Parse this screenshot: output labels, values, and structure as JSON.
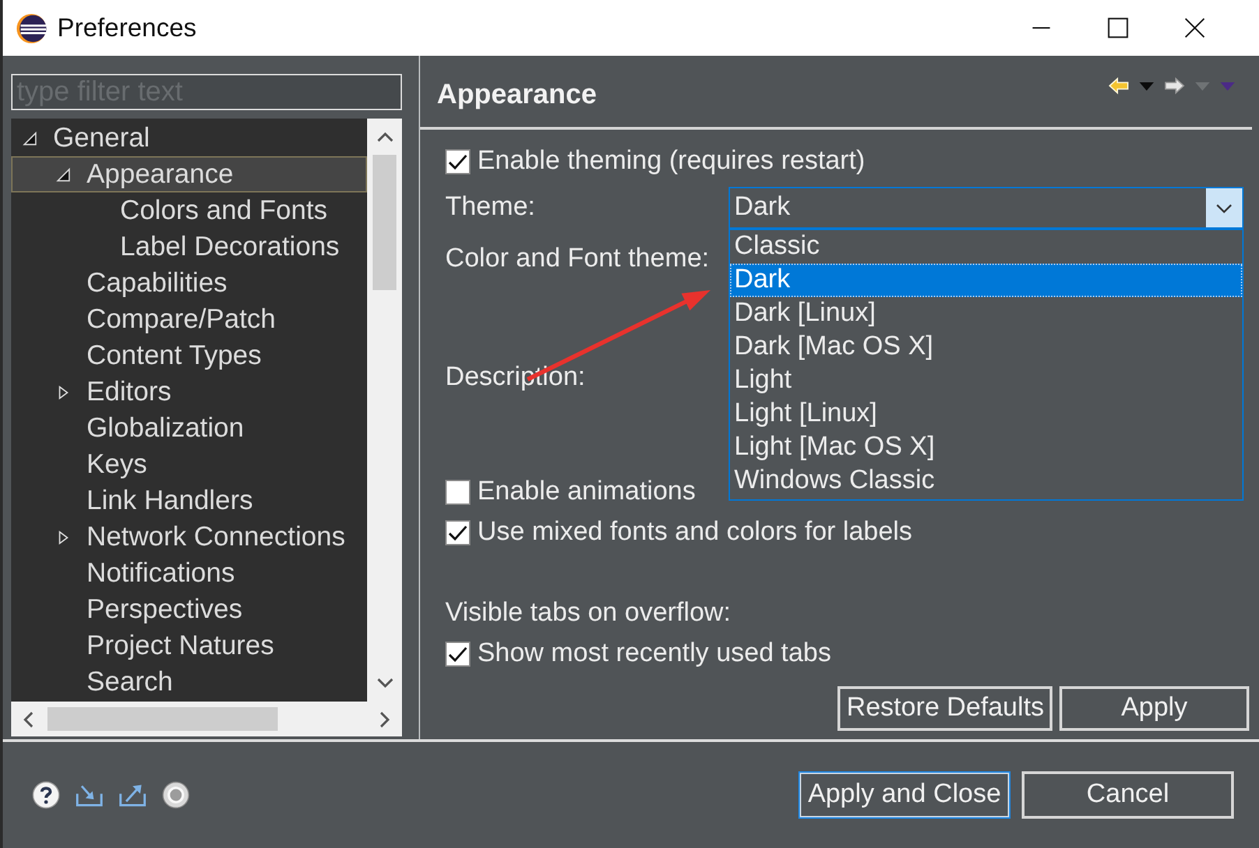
{
  "window": {
    "title": "Preferences"
  },
  "filter": {
    "placeholder": "type filter text"
  },
  "tree": {
    "items": [
      {
        "label": "General",
        "kind": "branch",
        "expanded": true,
        "selected": false,
        "children": [
          {
            "label": "Appearance",
            "kind": "branch",
            "expanded": true,
            "selected": true,
            "children": [
              {
                "label": "Colors and Fonts",
                "kind": "leaf",
                "selected": false
              },
              {
                "label": "Label Decorations",
                "kind": "leaf",
                "selected": false
              }
            ]
          },
          {
            "label": "Capabilities",
            "kind": "leaf",
            "selected": false
          },
          {
            "label": "Compare/Patch",
            "kind": "leaf",
            "selected": false
          },
          {
            "label": "Content Types",
            "kind": "leaf",
            "selected": false
          },
          {
            "label": "Editors",
            "kind": "branch",
            "expanded": false,
            "selected": false
          },
          {
            "label": "Globalization",
            "kind": "leaf",
            "selected": false
          },
          {
            "label": "Keys",
            "kind": "leaf",
            "selected": false
          },
          {
            "label": "Link Handlers",
            "kind": "leaf",
            "selected": false
          },
          {
            "label": "Network Connections",
            "kind": "branch",
            "expanded": false,
            "selected": false
          },
          {
            "label": "Notifications",
            "kind": "leaf",
            "selected": false
          },
          {
            "label": "Perspectives",
            "kind": "leaf",
            "selected": false
          },
          {
            "label": "Project Natures",
            "kind": "leaf",
            "selected": false
          },
          {
            "label": "Search",
            "kind": "leaf",
            "selected": false
          }
        ]
      }
    ]
  },
  "page": {
    "title": "Appearance",
    "history": [
      {
        "kind": "back",
        "disabled": false
      },
      {
        "kind": "forward",
        "disabled": true
      }
    ],
    "theming": {
      "label": "Enable theming (requires restart)",
      "checked": true
    },
    "theme": {
      "label": "Theme:",
      "value": "Dark",
      "open": true,
      "options": [
        {
          "label": "Classic",
          "selected": false
        },
        {
          "label": "Dark",
          "selected": true
        },
        {
          "label": "Dark [Linux]",
          "selected": false
        },
        {
          "label": "Dark [Mac OS X]",
          "selected": false
        },
        {
          "label": "Light",
          "selected": false
        },
        {
          "label": "Light [Linux]",
          "selected": false
        },
        {
          "label": "Light [Mac OS X]",
          "selected": false
        },
        {
          "label": "Windows Classic",
          "selected": false
        }
      ]
    },
    "color_font_theme": {
      "label": "Color and Font theme:"
    },
    "description": {
      "label": "Description:"
    },
    "options": [
      {
        "label": "Enable animations",
        "checked": false
      },
      {
        "label": "Use mixed fonts and colors for labels",
        "checked": true
      }
    ],
    "tabs_overflow": {
      "label": "Visible tabs on overflow:",
      "option": {
        "label": "Show most recently used tabs",
        "checked": true
      }
    },
    "buttons": [
      "Restore Defaults",
      "Apply"
    ]
  },
  "footer": {
    "buttons": [
      {
        "label": "Apply and Close",
        "focused": true
      },
      {
        "label": "Cancel",
        "focused": false
      }
    ]
  }
}
